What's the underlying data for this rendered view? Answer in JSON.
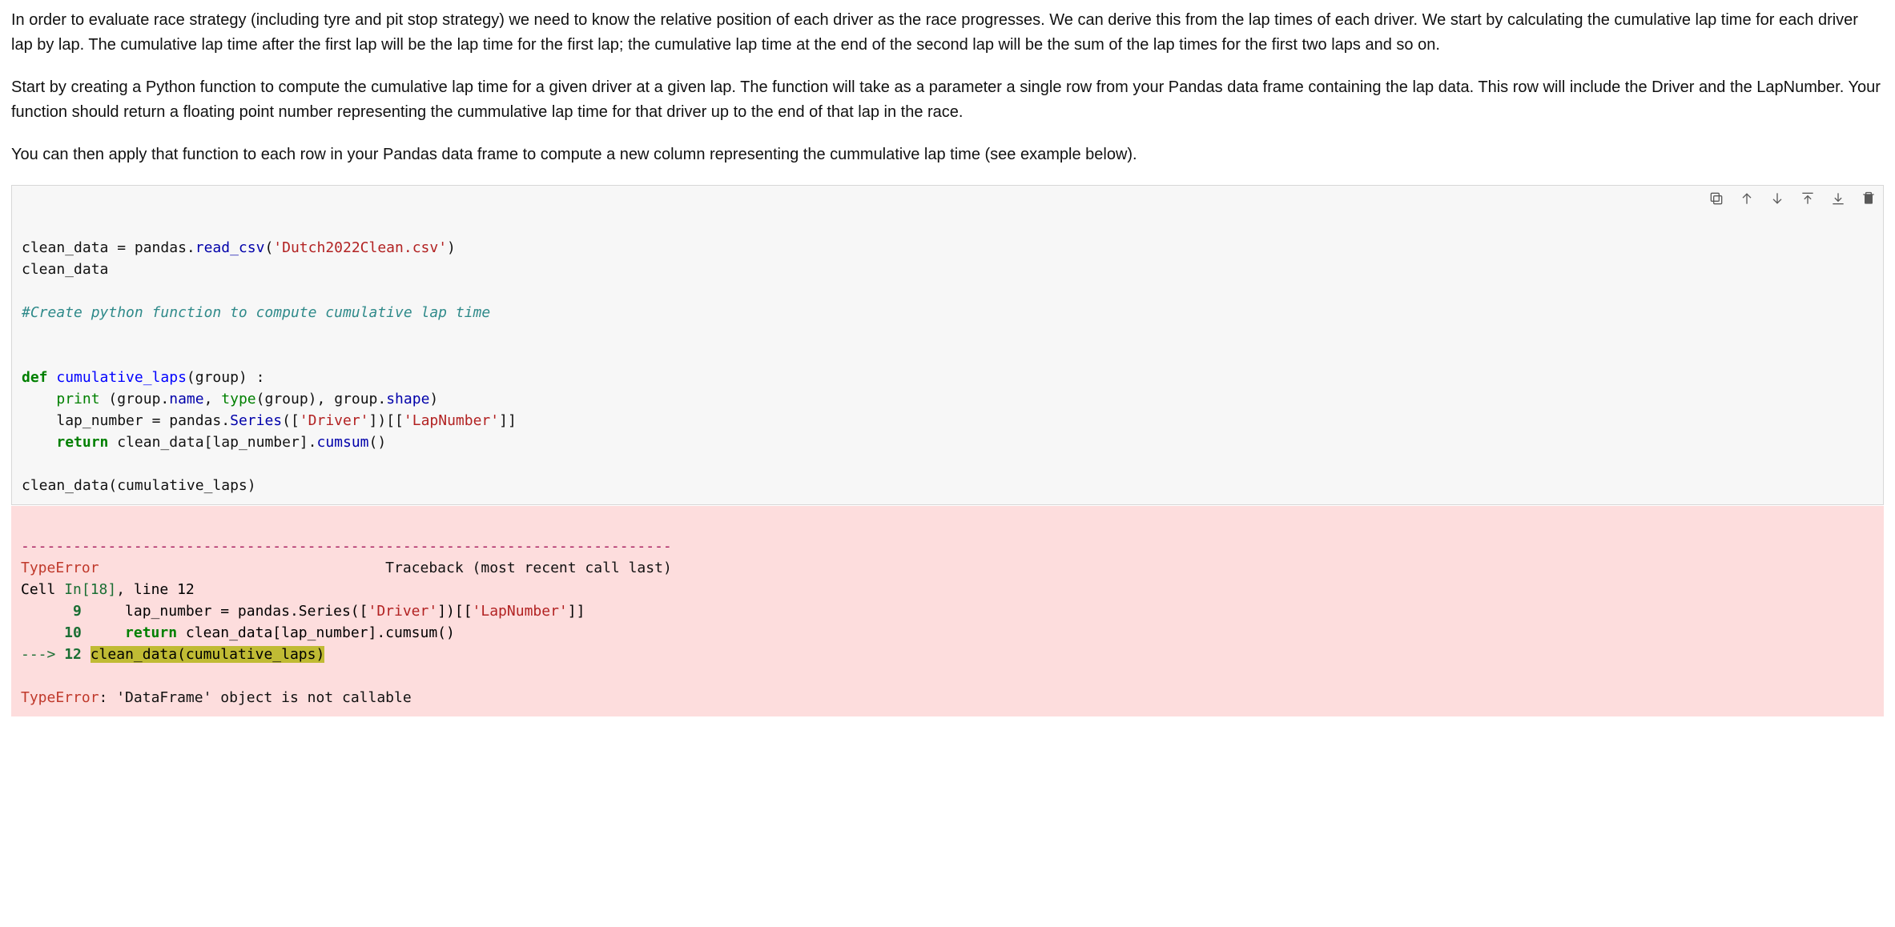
{
  "markdown": {
    "p1": "In order to evaluate race strategy (including tyre and pit stop strategy) we need to know the relative position of each driver as the race progresses. We can derive this from the lap times of each driver. We start by calculating the cumulative lap time for each driver lap by lap. The cumulative lap time after the first lap will be the lap time for the first lap; the cumulative lap time at the end of the second lap will be the sum of the lap times for the first two laps and so on.",
    "p2": "Start by creating a Python function to compute the cumulative lap time for a given driver at a given lap. The function will take as a parameter a single row from your Pandas data frame containing the lap data. This row will include the Driver and the LapNumber. Your function should return a floating point number representing the cummulative lap time for that driver up to the end of that lap in the race.",
    "p3": "You can then apply that function to each row in your Pandas data frame to compute a new column representing the cummulative lap time (see example below)."
  },
  "toolbar_labels": {
    "duplicate": "Duplicate cell",
    "move_up": "Move cell up",
    "move_down": "Move cell down",
    "insert_above": "Insert cell above",
    "insert_below": "Insert cell below",
    "delete": "Delete cell"
  },
  "code": {
    "l1_a": "clean_data = pandas.",
    "l1_fn": "read_csv",
    "l1_b": "(",
    "l1_str": "'Dutch2022Clean.csv'",
    "l1_c": ")",
    "l2": "clean_data",
    "blank": "",
    "l4_comment": "#Create python function to compute cumulative lap time",
    "l7_def": "def",
    "l7_name": " cumulative_laps",
    "l7_sig": "(group) :",
    "l8_ind": "    ",
    "l8_print": "print",
    "l8_a": " (group.",
    "l8_name_attr": "name",
    "l8_b": ", ",
    "l8_type": "type",
    "l8_c": "(group), group.",
    "l8_shape": "shape",
    "l8_d": ")",
    "l9_ind": "    ",
    "l9_a": "lap_number = pandas.",
    "l9_series": "Series",
    "l9_b": "([",
    "l9_s1": "'Driver'",
    "l9_c": "])[[",
    "l9_s2": "'LapNumber'",
    "l9_d": "]]",
    "l10_ind": "    ",
    "l10_ret": "return",
    "l10_a": " clean_data[lap_number].",
    "l10_cum": "cumsum",
    "l10_b": "()",
    "l12": "clean_data(cumulative_laps)"
  },
  "error": {
    "dashes": "---------------------------------------------------------------------------",
    "err_name": "TypeError",
    "tb_text": "                                 Traceback (most recent call last)",
    "cell_a": "Cell ",
    "cell_in": "In[18]",
    "cell_b": ", ",
    "cell_line": "line 12",
    "r9_no": "      9",
    "r9_a": "     lap_number = pandas.Series([",
    "r9_s1": "'Driver'",
    "r9_b": "])[[",
    "r9_s2": "'LapNumber'",
    "r9_c": "]]",
    "r10_no": "     10",
    "r10_a": "     ",
    "r10_ret": "return",
    "r10_b": " clean_data[lap_number].cumsum()",
    "arrow": "---> ",
    "r12_no": "12",
    "r12_sp": " ",
    "r12_hl": "clean_data(cumulative_laps)",
    "final_err": "TypeError",
    "final_msg": ": 'DataFrame' object is not callable"
  }
}
